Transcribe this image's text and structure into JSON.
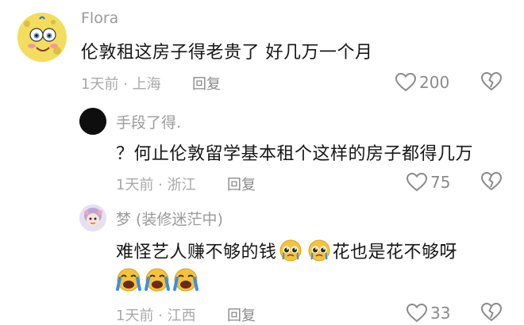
{
  "comments": [
    {
      "username": "Flora",
      "text": "伦敦租这房子得老贵了 好几万一个月",
      "meta": "1天前 · 上海",
      "reply_label": "回复",
      "likes": "200",
      "avatar_icon": "spongebob-avatar"
    },
    {
      "username": "手段了得.",
      "text": "？何止伦敦留学基本租个这样的房子都得几万",
      "meta": "1天前 · 浙江",
      "reply_label": "回复",
      "likes": "75",
      "avatar_icon": "black-circle-avatar"
    },
    {
      "username": "梦 (装修迷茫中)",
      "text_part1": "难怪艺人赚不够的钱",
      "text_part2": "花也是花不够呀",
      "meta": "1天前 · 江西",
      "reply_label": "回复",
      "likes": "33",
      "avatar_icon": "girl-avatar",
      "emojis_inline": [
        "pleading-face",
        "pleading-face"
      ],
      "emojis_row": [
        "crying-face",
        "crying-face",
        "crying-face"
      ]
    }
  ],
  "colors": {
    "heart_outline": "#8a8a8a",
    "emoji_yellow": "#f5c33b",
    "tear_blue": "#3b8fe0"
  }
}
